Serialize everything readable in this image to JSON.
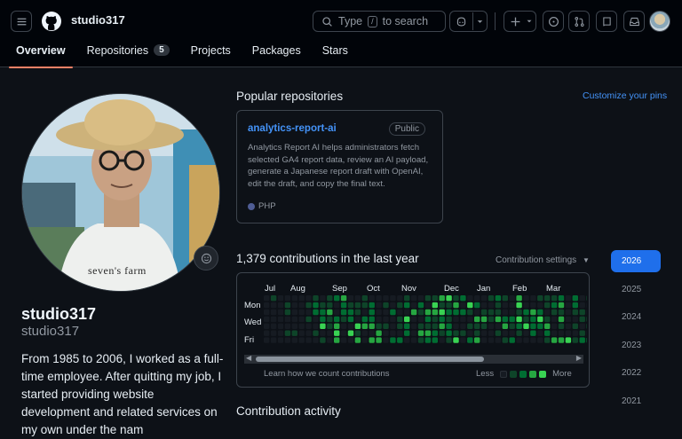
{
  "header": {
    "username": "studio317",
    "search_prefix": "Type",
    "search_key": "/",
    "search_suffix": "to search"
  },
  "tabs": [
    {
      "label": "Overview"
    },
    {
      "label": "Repositories",
      "count": "5"
    },
    {
      "label": "Projects"
    },
    {
      "label": "Packages"
    },
    {
      "label": "Stars"
    }
  ],
  "profile": {
    "shirt_text": "seven's farm",
    "full_name": "studio317",
    "login": "studio317",
    "bio": "From 1985 to 2006, I worked as a full-time employee. After quitting my job, I started providing website development and related services on my own under the nam"
  },
  "popular": {
    "title": "Popular repositories",
    "customize_link": "Customize your pins",
    "repos": [
      {
        "name": "analytics-report-ai",
        "visibility": "Public",
        "description": "Analytics Report AI helps administrators fetch selected GA4 report data, review an AI payload, generate a Japanese report draft with OpenAI, edit the draft, and copy the final text.",
        "language": "PHP",
        "language_color": "#4f5d95"
      }
    ]
  },
  "contributions": {
    "heading": "1,379 contributions in the last year",
    "settings_label": "Contribution settings",
    "months": [
      "Jul",
      "Aug",
      "Sep",
      "Oct",
      "Nov",
      "Dec",
      "Jan",
      "Feb",
      "Mar"
    ],
    "days": [
      "Mon",
      "Wed",
      "Fri"
    ],
    "learn_link": "Learn how we count contributions",
    "less": "Less",
    "more": "More",
    "colors": [
      "#161b22",
      "#0e4429",
      "#006d32",
      "#26a641",
      "#39d353"
    ]
  },
  "years": [
    "2026",
    "2025",
    "2024",
    "2023",
    "2022",
    "2021"
  ],
  "activity": {
    "title": "Contribution activity"
  }
}
